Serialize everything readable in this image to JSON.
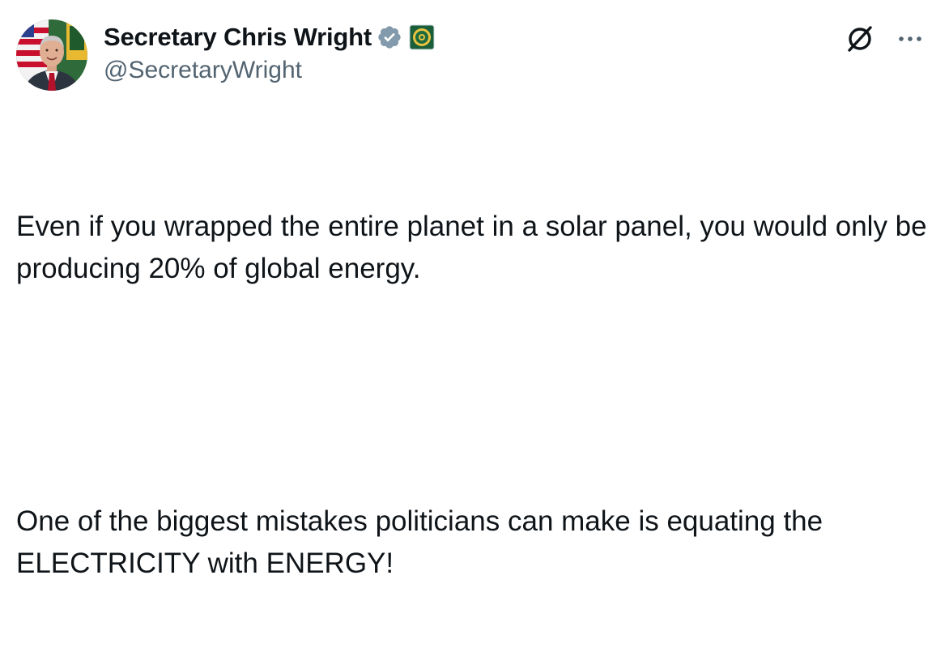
{
  "author": {
    "display_name": "Secretary Chris Wright",
    "handle": "@SecretaryWright",
    "verified_badge": "gray-verified-checkmark-icon",
    "affiliate_badge": "doe-seal-icon",
    "avatar": "profile-photo"
  },
  "actions": {
    "grok_icon": "grok-icon",
    "more_icon": "more-options-icon"
  },
  "tweet": {
    "paragraph_1": "Even if you wrapped the entire planet in a solar panel, you would only be producing 20% of global energy.",
    "paragraph_2": "One of the biggest mistakes politicians can make is equating the ELECTRICITY with ENERGY!"
  },
  "colors": {
    "text_primary": "#0f1419",
    "text_secondary": "#536471",
    "badge_gray": "#829aab",
    "background": "#ffffff"
  }
}
